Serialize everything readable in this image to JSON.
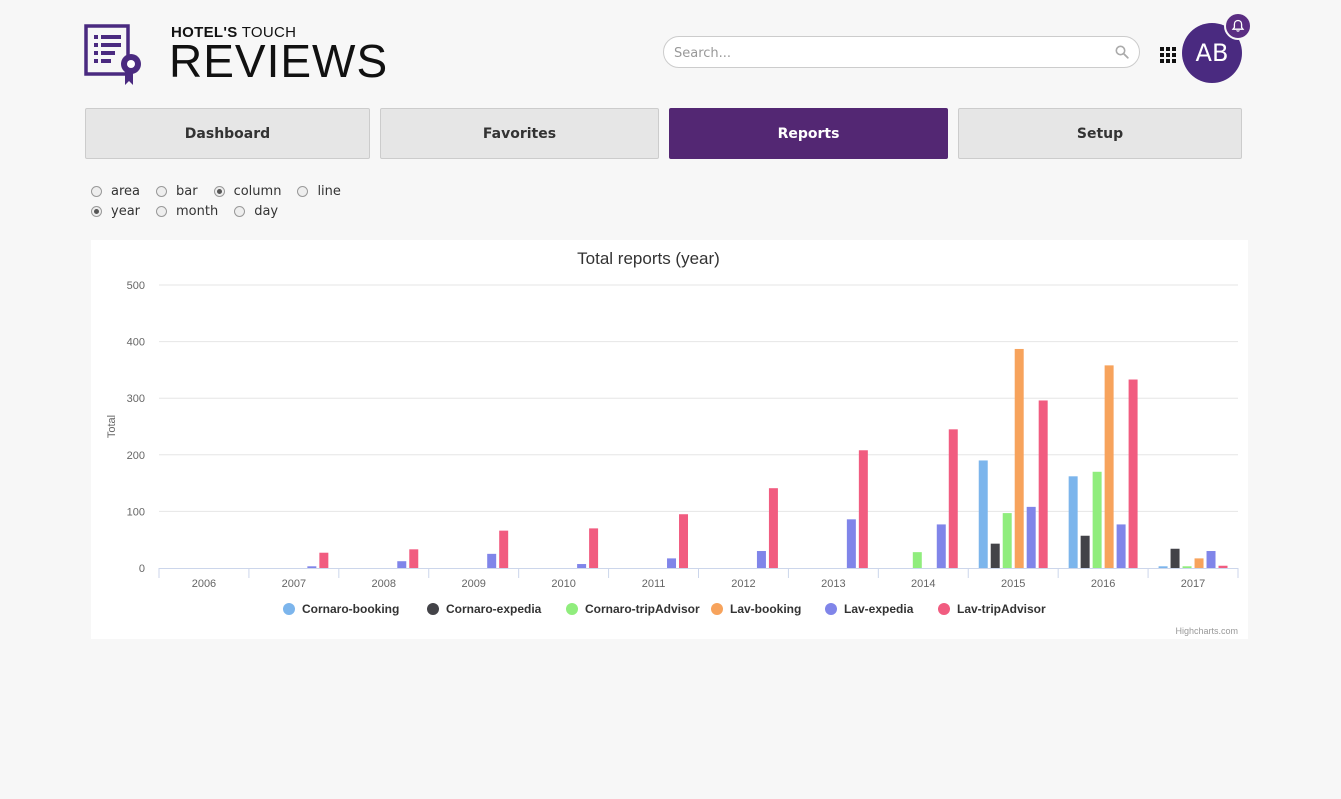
{
  "brand": {
    "small_bold": "HOTEL'S",
    "small_rest": " TOUCH",
    "big": "REVIEWS"
  },
  "search": {
    "placeholder": "Search..."
  },
  "user": {
    "initials": "AB"
  },
  "nav": [
    {
      "label": "Dashboard",
      "active": false
    },
    {
      "label": "Favorites",
      "active": false
    },
    {
      "label": "Reports",
      "active": true
    },
    {
      "label": "Setup",
      "active": false
    }
  ],
  "chart_types": [
    {
      "label": "area",
      "selected": false
    },
    {
      "label": "bar",
      "selected": false
    },
    {
      "label": "column",
      "selected": true
    },
    {
      "label": "line",
      "selected": false
    }
  ],
  "periods": [
    {
      "label": "year",
      "selected": true
    },
    {
      "label": "month",
      "selected": false
    },
    {
      "label": "day",
      "selected": false
    }
  ],
  "credits": "Highcharts.com",
  "chart_data": {
    "type": "bar",
    "title": "Total reports (year)",
    "xlabel": "",
    "ylabel": "Total",
    "ylim": [
      0,
      500
    ],
    "yticks": [
      0,
      100,
      200,
      300,
      400,
      500
    ],
    "grid": true,
    "legend_position": "bottom-center",
    "categories": [
      "2006",
      "2007",
      "2008",
      "2009",
      "2010",
      "2011",
      "2012",
      "2013",
      "2014",
      "2015",
      "2016",
      "2017"
    ],
    "series": [
      {
        "name": "Cornaro-booking",
        "color": "#7cb5ec",
        "values": [
          0,
          0,
          0,
          0,
          0,
          0,
          0,
          0,
          0,
          190,
          162,
          3
        ]
      },
      {
        "name": "Cornaro-expedia",
        "color": "#434348",
        "values": [
          0,
          0,
          0,
          0,
          0,
          0,
          0,
          0,
          0,
          43,
          57,
          34
        ]
      },
      {
        "name": "Cornaro-tripAdvisor",
        "color": "#90ed7d",
        "values": [
          0,
          0,
          0,
          0,
          0,
          0,
          0,
          0,
          28,
          97,
          170,
          3
        ]
      },
      {
        "name": "Lav-booking",
        "color": "#f7a35c",
        "values": [
          0,
          0,
          0,
          0,
          0,
          0,
          0,
          0,
          0,
          387,
          358,
          17
        ]
      },
      {
        "name": "Lav-expedia",
        "color": "#8085e9",
        "values": [
          0,
          3,
          12,
          25,
          7,
          17,
          30,
          86,
          77,
          108,
          77,
          30
        ]
      },
      {
        "name": "Lav-tripAdvisor",
        "color": "#f15c80",
        "values": [
          0,
          27,
          33,
          66,
          70,
          95,
          141,
          208,
          245,
          296,
          333,
          4
        ]
      }
    ]
  }
}
